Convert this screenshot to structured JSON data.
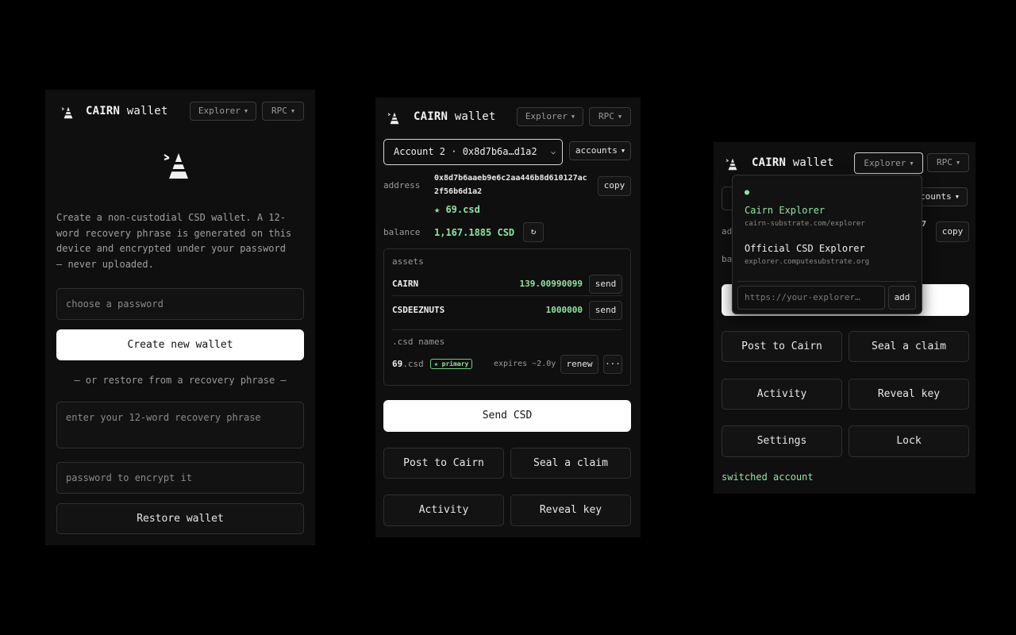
{
  "brand": {
    "name_bold": "CAIRN",
    "name_rest": "wallet"
  },
  "header": {
    "explorer_label": "Explorer",
    "rpc_label": "RPC"
  },
  "panel1": {
    "intro": "Create a non-custodial CSD wallet. A 12-word recovery phrase is generated on this device and encrypted under your password — never uploaded.",
    "password_placeholder": "choose a password",
    "create_label": "Create new wallet",
    "divider": "— or restore from a recovery phrase —",
    "phrase_placeholder": "enter your 12-word recovery phrase",
    "encrypt_placeholder": "password to encrypt it",
    "restore_label": "Restore wallet"
  },
  "panel2": {
    "account_select": "Account 2 · 0x8d7b6a…d1a2",
    "accounts_label": "accounts",
    "address_label": "address",
    "address_line1": "0x8d7b6aaeb9e6c2aa446b8d610127ac",
    "address_line2": "2f56b6d1a2",
    "copy_label": "copy",
    "primary_name": "★ 69.csd",
    "balance_label": "balance",
    "balance_value": "1,167.1885 CSD",
    "refresh_icon": "↻",
    "assets_label": "assets",
    "assets": [
      {
        "name": "CAIRN",
        "amount": "139.00990099",
        "action": "send"
      },
      {
        "name": "CSDEEZNUTS",
        "amount": "1000000",
        "action": "send"
      }
    ],
    "names_label": ".csd names",
    "name_entry": {
      "name": "69",
      "tld": ".csd",
      "badge": "★ primary",
      "expires": "expires ~2.0y",
      "renew": "renew",
      "more": "···"
    },
    "send_label": "Send CSD",
    "post_label": "Post to Cairn",
    "seal_label": "Seal a claim",
    "activity_label": "Activity",
    "reveal_label": "Reveal key"
  },
  "panel3": {
    "accounts_partial": "counts",
    "addr_partial": "ad",
    "addr_tail": "7",
    "copy_label": "copy",
    "bal_partial": "ba",
    "dropdown": {
      "items": [
        {
          "name": "Cairn Explorer",
          "url": "cairn-substrate.com/explorer",
          "active": true
        },
        {
          "name": "Official CSD Explorer",
          "url": "explorer.computesubstrate.org",
          "active": false
        }
      ],
      "input_placeholder": "https://your-explorer…",
      "add_label": "add"
    },
    "post_label": "Post to Cairn",
    "seal_label": "Seal a claim",
    "activity_label": "Activity",
    "reveal_label": "Reveal key",
    "settings_label": "Settings",
    "lock_label": "Lock",
    "status": "switched account"
  },
  "colors": {
    "accent_green": "#8fe3a0",
    "bg": "#000000",
    "panel": "#0f0f0f"
  }
}
